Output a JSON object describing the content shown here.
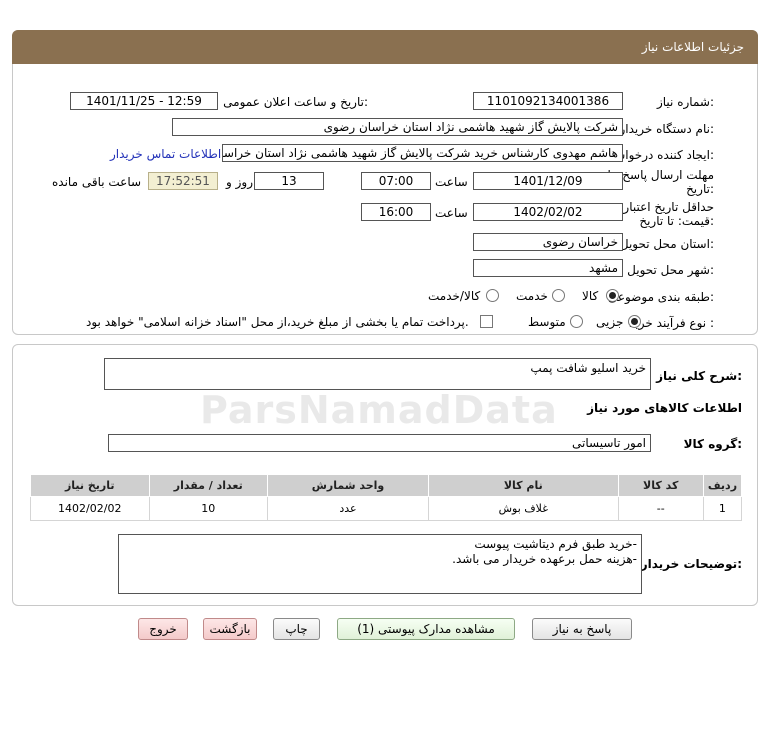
{
  "header": {
    "title": "جزئیات اطلاعات نیاز"
  },
  "form": {
    "need_number_label": "شماره نیاز:",
    "need_number": "1101092134001386",
    "announce_label": "تاریخ و ساعت اعلان عمومی:",
    "announce_value": "1401/11/25 - 12:59",
    "buyer_org_label": "نام دستگاه خریدار:",
    "buyer_org": "شرکت پالایش گاز شهید هاشمی نژاد   استان خراسان رضوی",
    "creator_label": "ایجاد کننده درخواست:",
    "creator": "هاشم مهدوی کارشناس خرید شرکت پالایش گاز شهید هاشمی نژاد   استان خراسان رضوی",
    "contact_link": "اطلاعات تماس خریدار",
    "deadline_label_1": "مهلت ارسال پاسخ: تا",
    "deadline_label_2": "تاریخ:",
    "deadline_date": "1401/12/09",
    "time_label": "ساعت",
    "deadline_time": "07:00",
    "days_value": "13",
    "days_label": "روز و",
    "remaining_timer": "17:52:51",
    "remaining_label": "ساعت باقی مانده",
    "validity_label_1": "حداقل تاریخ اعتبار",
    "validity_label_2": "قیمت: تا تاریخ:",
    "validity_date": "1402/02/02",
    "validity_time_label": "ساعت",
    "validity_time": "16:00",
    "province_label": "استان محل تحویل:",
    "province": "خراسان رضوی",
    "city_label": "شهر محل تحویل:",
    "city": "مشهد",
    "category_label": "طبقه بندی موضوعی:",
    "category_options": [
      "کالا",
      "خدمت",
      "کالا/خدمت"
    ],
    "process_label": "نوع فرآیند خرید :",
    "process_options": [
      "جزیی",
      "متوسط"
    ],
    "payment_note": "پرداخت تمام یا بخشی از مبلغ خرید،از محل \"اسناد خزانه اسلامی\" خواهد بود."
  },
  "details": {
    "summary_label": "شرح کلی نیاز:",
    "summary": "خرید اسلیو شافت پمپ",
    "goods_info_title": "اطلاعات کالاهای مورد نیاز",
    "goods_group_label": "گروه کالا:",
    "goods_group": "امور تاسیساتی",
    "table": {
      "headers": [
        "ردیف",
        "کد کالا",
        "نام کالا",
        "واحد شمارش",
        "تعداد / مقدار",
        "تاریخ نیاز"
      ],
      "rows": [
        [
          "1",
          "--",
          "غلاف بوش",
          "عدد",
          "10",
          "1402/02/02"
        ]
      ]
    },
    "notes_label": "توضیحات خریدار:",
    "notes_line1": "-خرید طبق فرم دیتاشیت پیوست",
    "notes_line2": "-هزینه حمل برعهده خریدار می باشد."
  },
  "buttons": {
    "reply": "پاسخ به نیاز",
    "view_docs": "مشاهده مدارک پیوستی (1)",
    "print": "چاپ",
    "back": "بازگشت",
    "exit": "خروج"
  },
  "watermark": "ParsNamadData",
  "colors": {
    "header_bg": "#8a7050",
    "link": "#2231b8",
    "timer_bg": "#f3efd2"
  }
}
